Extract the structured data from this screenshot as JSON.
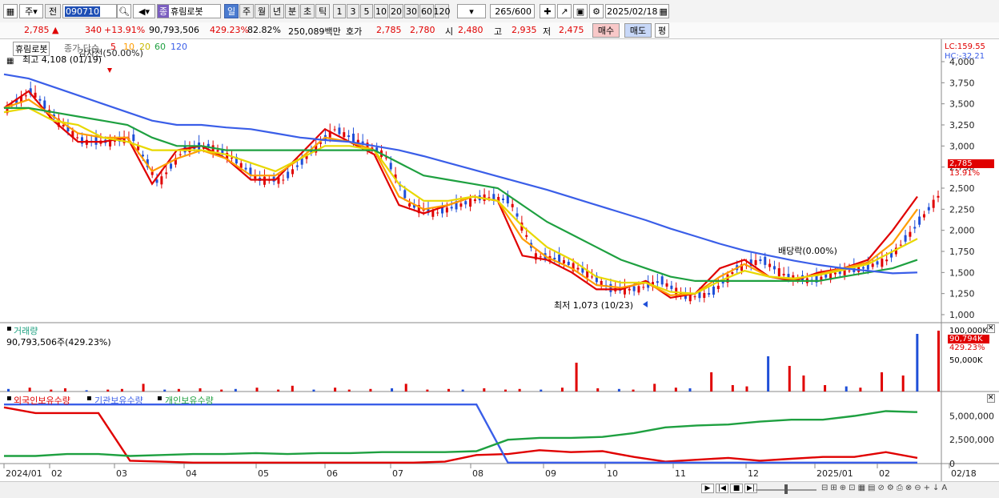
{
  "toolbar": {
    "period_select": "주",
    "prev_label": "전",
    "stock_code": "090710",
    "stock_badge": "종",
    "stock_name": "휴림로봇",
    "timeframes": [
      "일",
      "주",
      "월",
      "년",
      "분",
      "초",
      "틱"
    ],
    "active_timeframe": "일",
    "intervals": [
      "1",
      "3",
      "5",
      "10",
      "20",
      "30",
      "60",
      "120"
    ],
    "range_display": "265/600",
    "date": "2025/02/18"
  },
  "quote": {
    "price": "2,785 ▲",
    "change": "340",
    "change_pct": "+13.91%",
    "volume": "90,793,506",
    "volume_ratio": "429.23%",
    "rate": "82.82%",
    "amount": "250,089백만",
    "ask_label": "호가",
    "ask": "2,785",
    "bid": "2,780",
    "open_label": "시",
    "open": "2,480",
    "high_label": "고",
    "high": "2,935",
    "low_label": "저",
    "low": "2,475",
    "buy_label": "매수",
    "sell_label": "매도",
    "flat_label": "평"
  },
  "price_panel": {
    "stock_name": "휴림로봇",
    "legend_prefix": "종가 단순",
    "ma_periods": [
      "5",
      "10",
      "20",
      "60",
      "120"
    ],
    "ma_colors": [
      "#e00000",
      "#ff9d00",
      "#e8d800",
      "#1ea040",
      "#3a5ee8"
    ],
    "overlay_text": "감자전(50.00%)",
    "high_marker": "최고 4,108 (01/19)",
    "low_marker": "최저 1,073 (10/23)",
    "dividend_marker": "배당락(0.00%)",
    "lc": "LC:159.55",
    "hc": "HC:-32.21",
    "price_tag": "2,785",
    "pct_tag": "13.91%"
  },
  "volume_panel": {
    "title": "거래량",
    "value": "90,793,506주(429.23%)",
    "max_label": "100,000K",
    "current_tag": "90,794K",
    "pct_tag": "429.23%",
    "mid_label": "50,000K"
  },
  "holdings_panel": {
    "legends": [
      "외국인보유수량",
      "기관보유수량",
      "개인보유수량"
    ],
    "legend_colors": [
      "#e00000",
      "#3a5ee8",
      "#1ea040"
    ],
    "ticks": [
      "5,000,000",
      "2,500,000",
      "0"
    ]
  },
  "chart_data": {
    "type": "line",
    "title": "휴림로봇",
    "x_tick_labels": [
      "2024/01",
      "02",
      "03",
      "04",
      "05",
      "06",
      "07",
      "08",
      "09",
      "10",
      "11",
      "12",
      "2025/01",
      "02",
      "02/18"
    ],
    "price_axis_labels": [
      "4,000",
      "3,750",
      "3,500",
      "3,250",
      "3,000",
      "2,750",
      "2,500",
      "2,250",
      "2,000",
      "1,750",
      "1,500",
      "1,250",
      "1,000"
    ],
    "ylim": [
      1000,
      4000
    ],
    "series": [
      {
        "name": "5",
        "values": [
          3450,
          3650,
          3300,
          3050,
          3050,
          3100,
          2550,
          2950,
          3000,
          2850,
          2600,
          2600,
          2900,
          3200,
          3050,
          2900,
          2300,
          2200,
          2300,
          2400,
          2350,
          1700,
          1650,
          1500,
          1300,
          1300,
          1400,
          1200,
          1250,
          1550,
          1650,
          1450,
          1400,
          1500,
          1550,
          1650,
          2000,
          2400
        ]
      },
      {
        "name": "10",
        "values": [
          3450,
          3550,
          3350,
          3150,
          3100,
          3100,
          2700,
          2850,
          2950,
          2850,
          2650,
          2650,
          2850,
          3100,
          3050,
          2950,
          2400,
          2250,
          2300,
          2400,
          2350,
          1900,
          1680,
          1550,
          1350,
          1320,
          1380,
          1230,
          1250,
          1450,
          1600,
          1450,
          1420,
          1480,
          1550,
          1620,
          1850,
          2250
        ]
      },
      {
        "name": "20",
        "values": [
          3400,
          3450,
          3300,
          3250,
          3100,
          3050,
          2950,
          2950,
          2950,
          2900,
          2800,
          2700,
          2850,
          3000,
          3000,
          2950,
          2550,
          2350,
          2350,
          2400,
          2350,
          2050,
          1800,
          1650,
          1450,
          1380,
          1380,
          1270,
          1250,
          1400,
          1520,
          1450,
          1430,
          1470,
          1530,
          1600,
          1750,
          1900
        ]
      },
      {
        "name": "60",
        "values": [
          3450,
          3450,
          3400,
          3350,
          3300,
          3250,
          3100,
          3000,
          3000,
          2950,
          2950,
          2950,
          2950,
          2950,
          2950,
          2950,
          2800,
          2650,
          2600,
          2550,
          2500,
          2300,
          2100,
          1950,
          1800,
          1650,
          1550,
          1450,
          1400,
          1400,
          1400,
          1400,
          1400,
          1400,
          1450,
          1500,
          1550,
          1650
        ]
      },
      {
        "name": "120",
        "values": [
          3850,
          3800,
          3700,
          3600,
          3500,
          3400,
          3300,
          3250,
          3250,
          3220,
          3200,
          3150,
          3100,
          3070,
          3050,
          3000,
          2950,
          2880,
          2800,
          2720,
          2640,
          2560,
          2480,
          2390,
          2300,
          2210,
          2120,
          2020,
          1930,
          1840,
          1760,
          1700,
          1640,
          1590,
          1550,
          1520,
          1490,
          1500
        ]
      }
    ],
    "volume_values": [
      4,
      6,
      3,
      5,
      2,
      3,
      4,
      12,
      3,
      4,
      5,
      3,
      4,
      6,
      3,
      9,
      3,
      6,
      3,
      4,
      5,
      12,
      3,
      4,
      3,
      5,
      3,
      4,
      3,
      6,
      45,
      5,
      4,
      3,
      12,
      6,
      5,
      30,
      10,
      8,
      55,
      40,
      25,
      10,
      8,
      6,
      30,
      25,
      90,
      95
    ],
    "holdings": {
      "foreign": [
        5900000,
        5300000,
        5300000,
        5300000,
        300000,
        200000,
        100000,
        100000,
        100000,
        100000,
        100000,
        100000,
        100000,
        100000,
        200000,
        900000,
        1000000,
        1400000,
        1200000,
        1300000,
        700000,
        200000,
        400000,
        600000,
        300000,
        500000,
        700000,
        700000,
        1200000,
        600000
      ],
      "institution": [
        6200000,
        6200000,
        6200000,
        6200000,
        6200000,
        6200000,
        6200000,
        6200000,
        6200000,
        6200000,
        6200000,
        6200000,
        6200000,
        6200000,
        6200000,
        6200000,
        100000,
        100000,
        100000,
        100000,
        100000,
        100000,
        100000,
        100000,
        100000,
        100000,
        100000,
        100000,
        100000,
        100000
      ],
      "individual": [
        800000,
        800000,
        1000000,
        1000000,
        800000,
        900000,
        1000000,
        1000000,
        1100000,
        1000000,
        1100000,
        1100000,
        1200000,
        1200000,
        1200000,
        1300000,
        2500000,
        2700000,
        2700000,
        2800000,
        3200000,
        3800000,
        4000000,
        4100000,
        4400000,
        4600000,
        4600000,
        5000000,
        5500000,
        5400000
      ]
    }
  },
  "bottom": {
    "scroll_buttons": [
      "▶",
      "|◀",
      "■",
      "▶|"
    ]
  }
}
